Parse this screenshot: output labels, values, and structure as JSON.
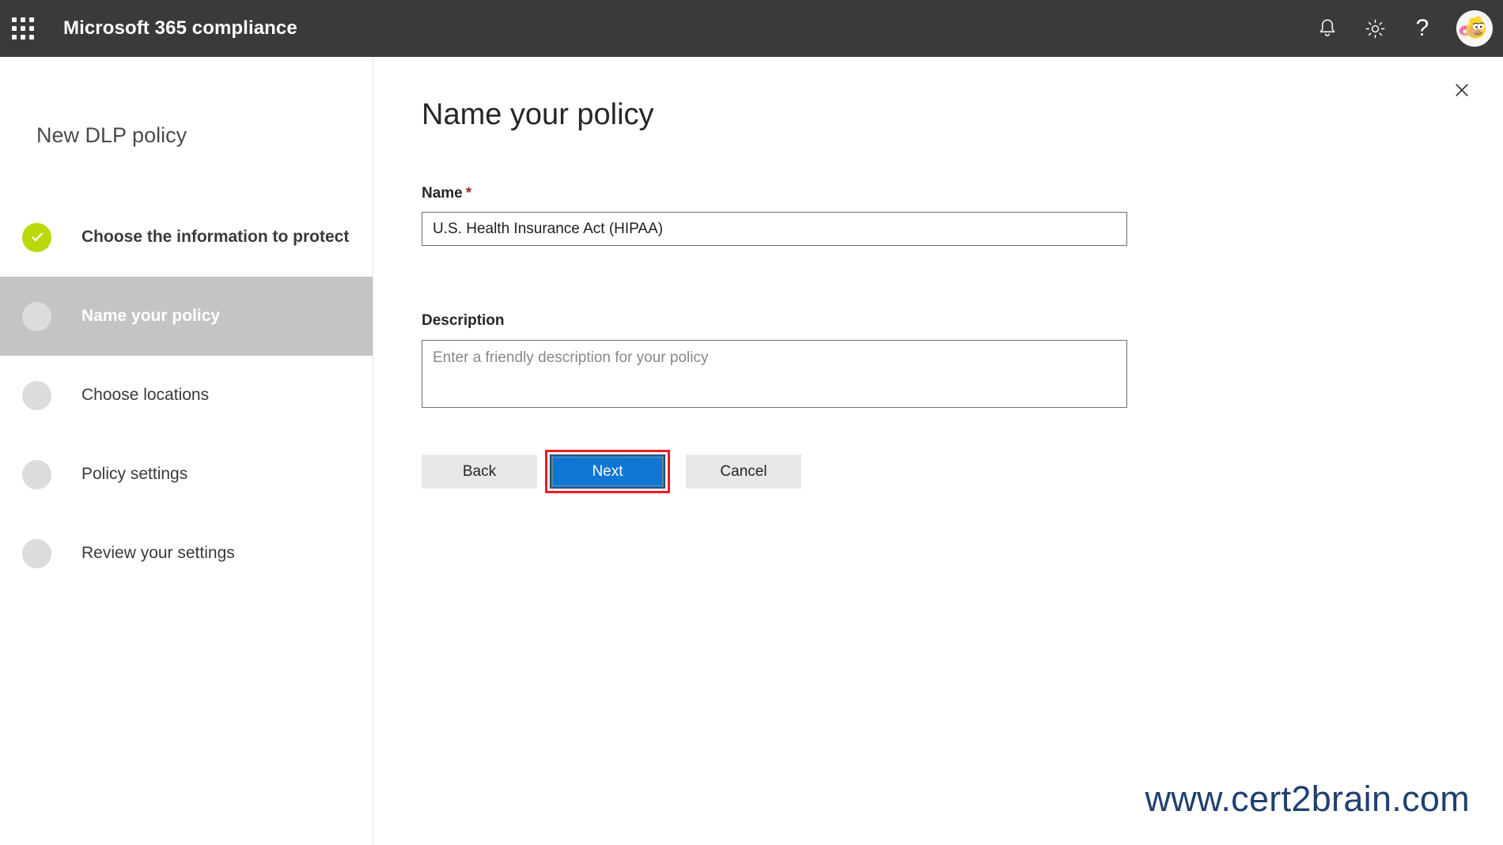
{
  "suite": {
    "waffle_icon": "app-launcher-waffle-icon",
    "title": "Microsoft 365 compliance",
    "icons": [
      {
        "name": "notifications-bell-icon",
        "glyph": "bell"
      },
      {
        "name": "settings-gear-icon",
        "glyph": "gear"
      },
      {
        "name": "help-question-icon",
        "glyph": "?"
      }
    ],
    "avatar": {
      "name": "user-avatar",
      "alt": "Homer Simpson profile picture"
    }
  },
  "wizard": {
    "title": "New DLP policy",
    "steps": [
      {
        "label": "Choose the information to protect",
        "state": "done"
      },
      {
        "label": "Name your policy",
        "state": "active"
      },
      {
        "label": "Choose locations",
        "state": "pending"
      },
      {
        "label": "Policy settings",
        "state": "pending"
      },
      {
        "label": "Review your settings",
        "state": "pending"
      }
    ]
  },
  "panel": {
    "close_label": "Close",
    "page_title": "Name your policy",
    "name_field": {
      "label": "Name",
      "required_mark": "*",
      "value": "U.S. Health Insurance Act (HIPAA)",
      "placeholder": ""
    },
    "description_field": {
      "label": "Description",
      "value": "",
      "placeholder": "Enter a friendly description for your policy"
    },
    "buttons": {
      "back": "Back",
      "next": "Next",
      "cancel": "Cancel"
    }
  },
  "watermark": "www.cert2brain.com",
  "colors": {
    "suite_bar": "#3b3a39",
    "step_done": "#bad80a",
    "step_active_bg": "#c4c4c4",
    "primary_button": "#0f76d3",
    "required_star": "#a4262c",
    "highlight_border": "#ec1c24",
    "watermark": "#1f4070"
  }
}
